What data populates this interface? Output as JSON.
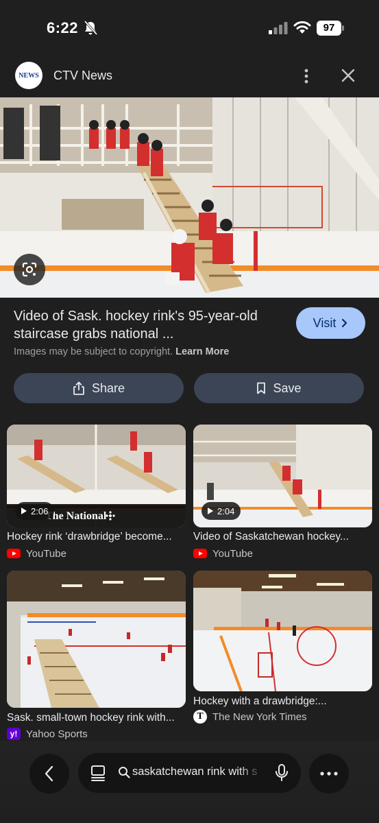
{
  "status_bar": {
    "time": "6:22",
    "battery": "97"
  },
  "source": {
    "logo_text": "NEWS",
    "name": "CTV News"
  },
  "result": {
    "title": "Video of Sask. hockey rink's 95-year-old staircase grabs national ...",
    "visit_label": "Visit",
    "copyright_text": "Images may be subject to copyright.",
    "learn_more": "Learn More"
  },
  "actions": {
    "share_label": "Share",
    "save_label": "Save"
  },
  "related": [
    {
      "title": "Hockey rink ‘drawbridge’ become...",
      "source": "YouTube",
      "source_icon": "youtube-icon",
      "duration": "2:06",
      "overlay_text": "The National"
    },
    {
      "title": "Video of Saskatchewan hockey...",
      "source": "YouTube",
      "source_icon": "youtube-icon",
      "duration": "2:04"
    },
    {
      "title": "Sask. small-town hockey rink with...",
      "source": "Yahoo Sports",
      "source_icon": "yahoo-icon",
      "source_icon_text": "y!"
    },
    {
      "title": "Hockey with a drawbridge:...",
      "source": "The New York Times",
      "source_icon": "nyt-icon",
      "source_icon_text": "T"
    }
  ],
  "bottom_bar": {
    "search_query": "saskatchewan rink with s"
  },
  "colors": {
    "background": "#1f1f1f",
    "visit_button": "#a8c7fa",
    "action_button": "#3c4555",
    "rink_red": "#d32f2f",
    "rink_orange": "#f28c28"
  }
}
